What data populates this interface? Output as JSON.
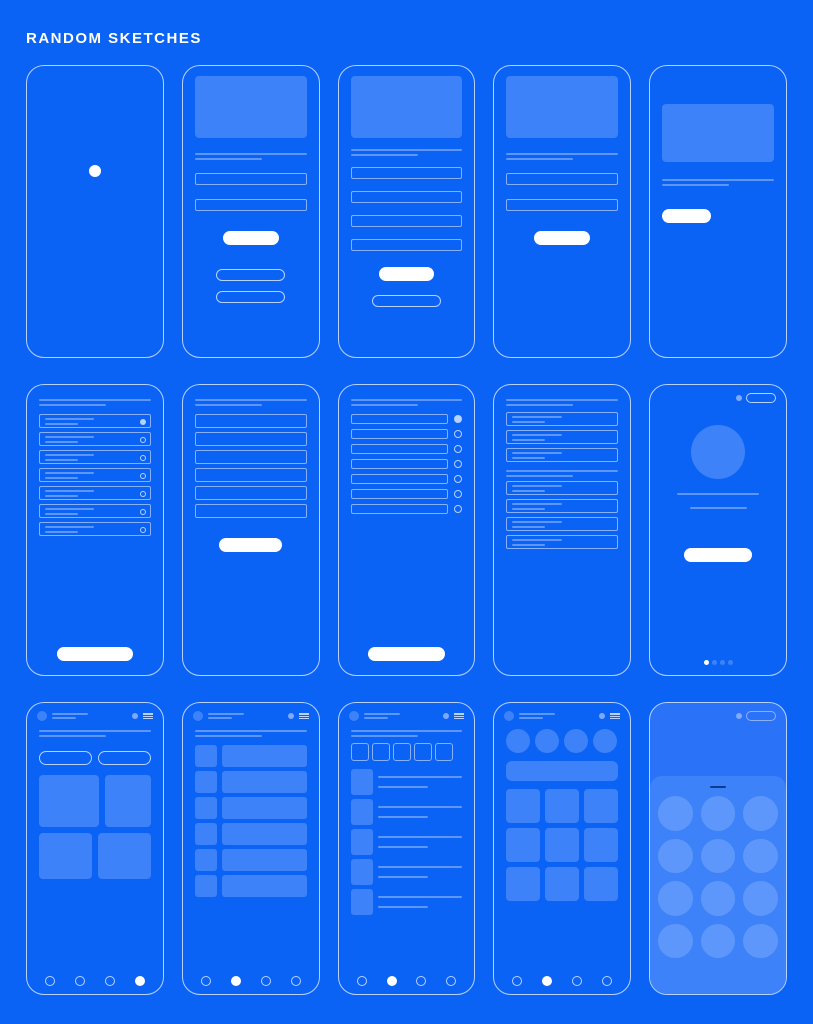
{
  "title": "RANDOM SKETCHES"
}
